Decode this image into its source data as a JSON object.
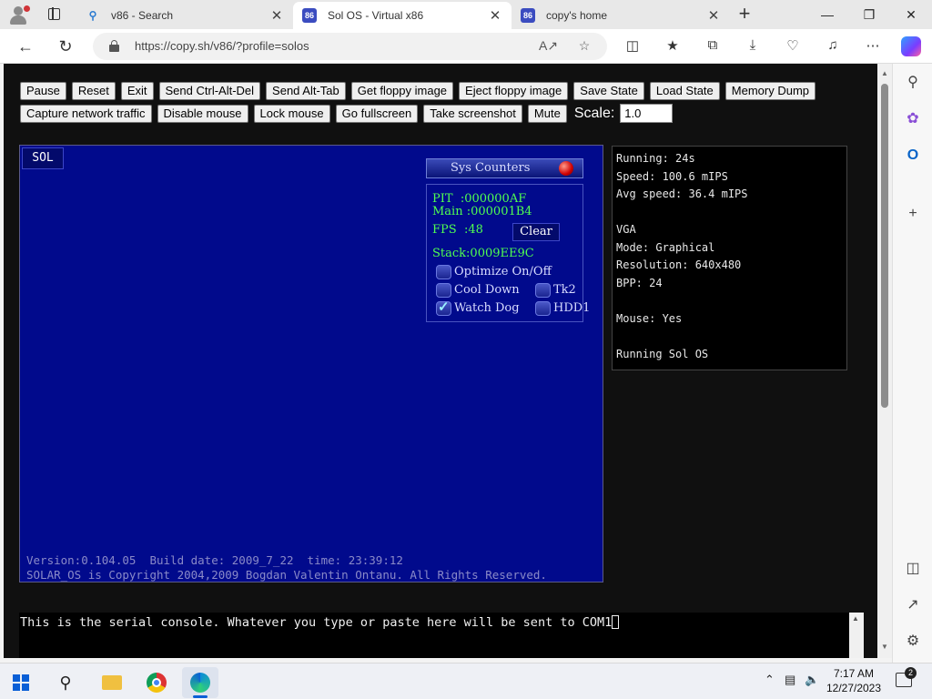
{
  "browser": {
    "tabs": [
      {
        "title": "v86 - Search",
        "favicon": "search-icon",
        "active": false
      },
      {
        "title": "Sol OS - Virtual x86",
        "favicon": "v86-icon",
        "active": true
      },
      {
        "title": "copy's home",
        "favicon": "v86-icon",
        "active": false
      }
    ],
    "url": "https://copy.sh/v86/?profile=solos"
  },
  "toolbar_buttons_row1": [
    "Pause",
    "Reset",
    "Exit",
    "Send Ctrl-Alt-Del",
    "Send Alt-Tab",
    "Get floppy image",
    "Eject floppy image",
    "Save State",
    "Load State",
    "Memory Dump"
  ],
  "toolbar_buttons_row2": [
    "Capture network traffic",
    "Disable mouse",
    "Lock mouse",
    "Go fullscreen",
    "Take screenshot",
    "Mute"
  ],
  "scale": {
    "label": "Scale:",
    "value": "1.0"
  },
  "vm": {
    "sol_button": "SOL",
    "sys_counters": {
      "title": "Sys Counters",
      "pit": "PIT  :000000AF",
      "main": "Main :000001B4",
      "fps": "FPS  :48",
      "clear": "Clear",
      "stack": "Stack:0009EE9C",
      "checkboxes": [
        {
          "label": "Optimize On/Off",
          "checked": false
        },
        {
          "label": "Cool Down",
          "checked": false
        },
        {
          "label": "Tk2",
          "checked": false
        },
        {
          "label": "Watch Dog",
          "checked": true
        },
        {
          "label": "HDD1",
          "checked": false
        }
      ]
    },
    "footer_line1": "Version:0.104.05  Build date: 2009_7_22  time: 23:39:12",
    "footer_line2": "SOLAR_OS is Copyright 2004,2009 Bogdan Valentin Ontanu. All Rights Reserved."
  },
  "info": {
    "running": "Running: 24s",
    "speed": "Speed: 100.6 mIPS",
    "avg_speed": "Avg speed: 36.4 mIPS",
    "vga": "VGA",
    "mode": "Mode: Graphical",
    "resolution": "Resolution: 640x480",
    "bpp": "BPP: 24",
    "mouse": "Mouse: Yes",
    "running_os": "Running Sol OS"
  },
  "serial_console": "This is the serial console. Whatever you type or paste here will be sent to COM1",
  "taskbar": {
    "time": "7:17 AM",
    "date": "12/27/2023",
    "notifications": "2"
  }
}
